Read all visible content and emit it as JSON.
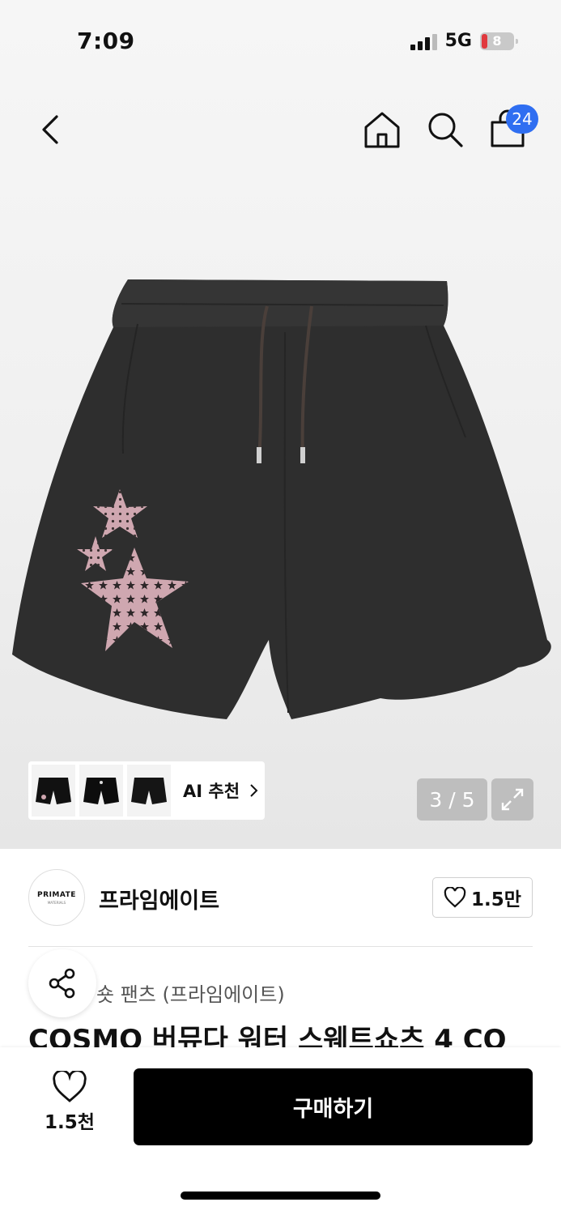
{
  "status_bar": {
    "time": "7:09",
    "network": "5G",
    "battery_level": "8"
  },
  "nav": {
    "cart_count": "24"
  },
  "gallery": {
    "ai_recommend_label": "AI 추천",
    "page_indicator": "3 / 5",
    "thumbnails": [
      "shorts-thumb-1",
      "shorts-thumb-2",
      "shorts-thumb-3"
    ]
  },
  "brand": {
    "logo_text": "PRIMATE",
    "logo_subtext": "MATERIALS",
    "name": "프라임에이트",
    "like_count": "1.5만"
  },
  "product": {
    "category": "숏 팬츠 (프라임에이트)",
    "title": "COSMO 버뮤다 워터 스웨트쇼츠 4 CO"
  },
  "bottom_bar": {
    "like_count": "1.5천",
    "buy_label": "구매하기"
  },
  "colors": {
    "accent_badge": "#2f6ef1",
    "buy_button": "#000000",
    "battery_low": "#e0393e"
  }
}
